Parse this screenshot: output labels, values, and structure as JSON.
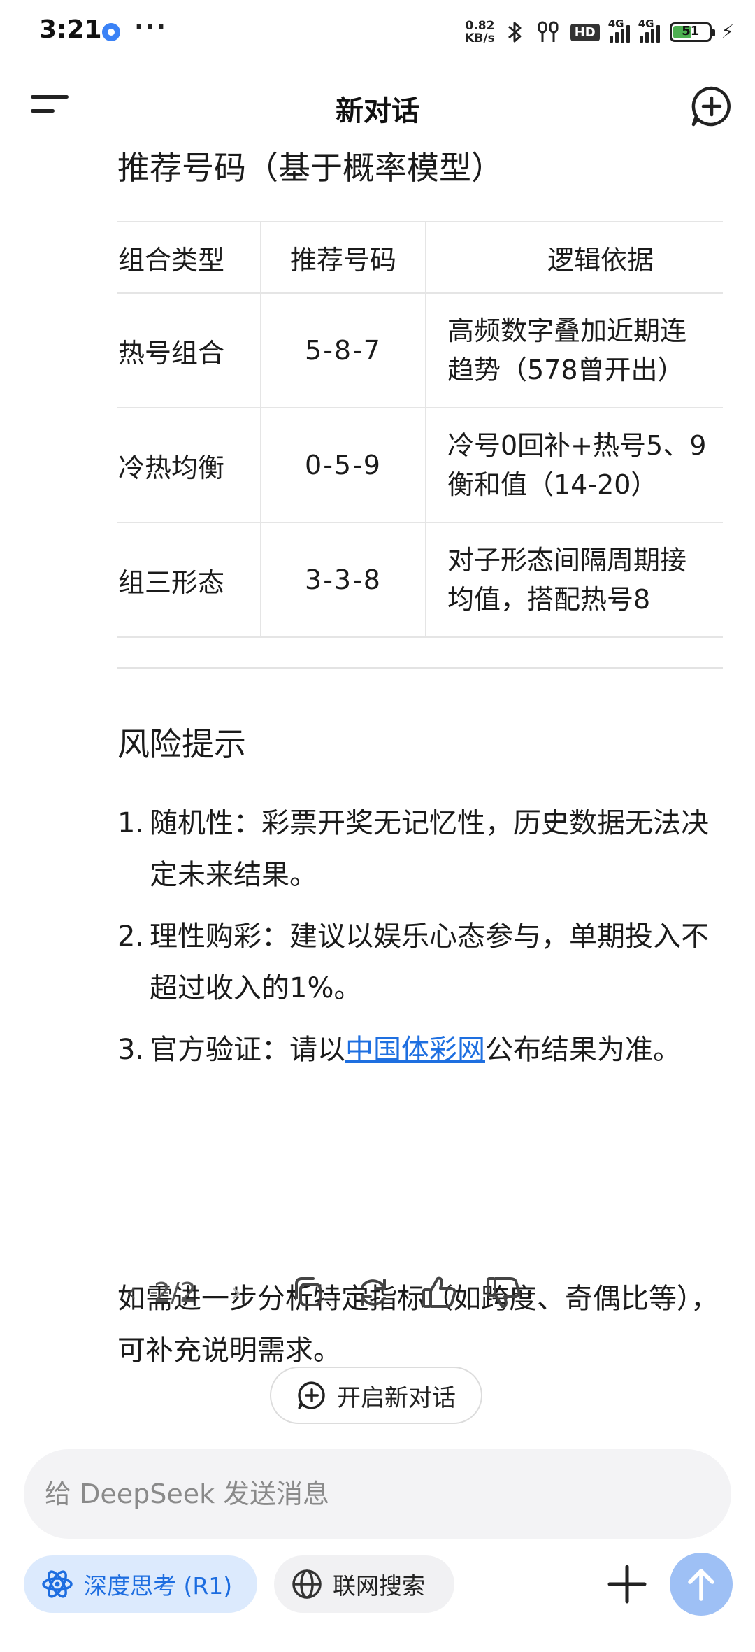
{
  "status_bar": {
    "time": "3:21",
    "more": "···",
    "net_speed_value": "0.82",
    "net_speed_unit": "KB/s",
    "hd": "HD",
    "sig1": "4G",
    "sig2": "4G",
    "battery": "51"
  },
  "header": {
    "title": "新对话"
  },
  "recommend": {
    "heading": "推荐号码（基于概率模型）",
    "columns": [
      "组合类型",
      "推荐号码",
      "逻辑依据"
    ],
    "rows": [
      {
        "type": "热号组合",
        "number": "5-8-7",
        "reason_line1": "高频数字叠加近期连",
        "reason_line2": "趋势（578曾开出）"
      },
      {
        "type": "冷热均衡",
        "number": "0-5-9",
        "reason_line1": "冷号0回补+热号5、9",
        "reason_line2": "衡和值（14-20）"
      },
      {
        "type": "组三形态",
        "number": "3-3-8",
        "reason_line1": "对子形态间隔周期接",
        "reason_line2": "均值，搭配热号8"
      }
    ]
  },
  "risk": {
    "heading": "风险提示",
    "items": [
      {
        "num": "1.",
        "text": "随机性：彩票开奖无记忆性，历史数据无法决定未来结果。"
      },
      {
        "num": "2.",
        "text": "理性购彩：建议以娱乐心态参与，单期投入不超过收入的1%。"
      },
      {
        "num": "3.",
        "text_before": "官方验证：请以",
        "link": "中国体彩网",
        "text_after": "公布结果为准。"
      }
    ]
  },
  "closing": "如需进一步分析特定指标（如跨度、奇偶比等），可补充说明需求。",
  "actions": {
    "pager": "2/2"
  },
  "new_chat_button": "开启新对话",
  "input": {
    "placeholder": "给 DeepSeek 发送消息"
  },
  "chips": {
    "deep_think": "深度思考 (R1)",
    "web_search": "联网搜索"
  },
  "colors": {
    "accent": "#1d6de0",
    "chip_bg": "#dceafd",
    "send_bg": "#9ec0f5"
  }
}
